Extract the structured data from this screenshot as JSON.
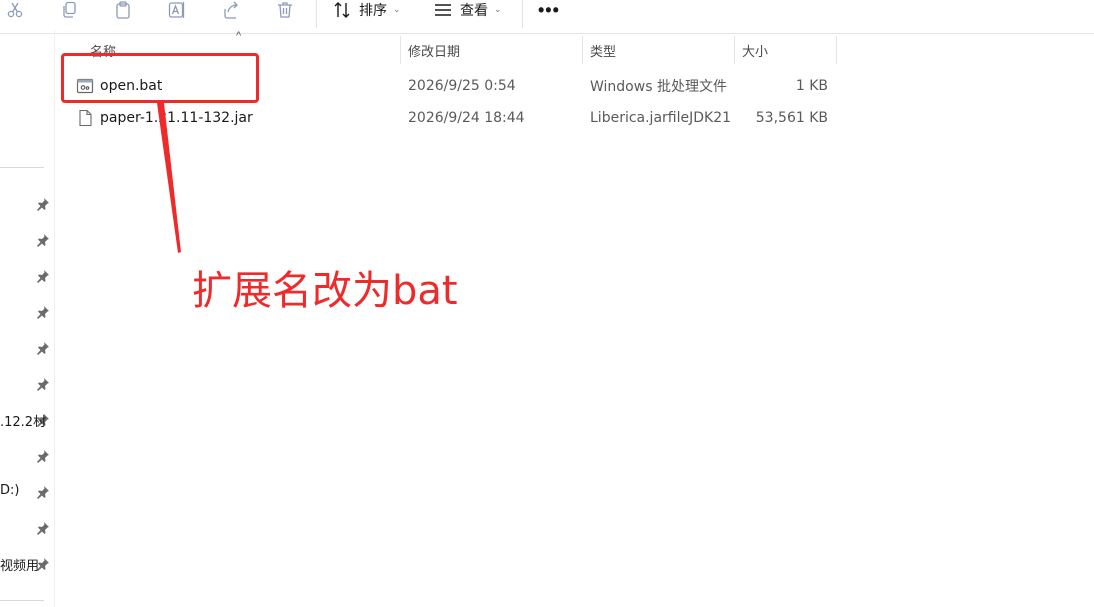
{
  "toolbar": {
    "sort_label": "排序",
    "view_label": "查看",
    "more_label": "•••"
  },
  "columns": {
    "name": "名称",
    "modified": "修改日期",
    "type": "类型",
    "size": "大小"
  },
  "files": [
    {
      "name": "open.bat",
      "modified": "2026/9/25 0:54",
      "type": "Windows 批处理文件",
      "size": "1 KB",
      "icon": "batch-file-icon"
    },
    {
      "name": "paper-1.21.11-132.jar",
      "modified": "2026/9/24 18:44",
      "type": "Liberica.jarfileJDK21",
      "size": "53,561 KB",
      "icon": "document-file-icon"
    }
  ],
  "nav": {
    "labels": [
      ".12.2村",
      "D:)",
      "视频用"
    ]
  },
  "annotation": {
    "text": "扩展名改为bat",
    "color": "#ee2a2a"
  }
}
